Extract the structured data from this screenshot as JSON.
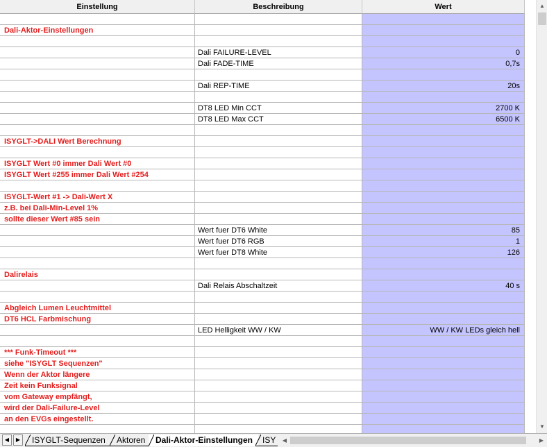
{
  "columns": [
    "Einstellung",
    "Beschreibung",
    "Wert"
  ],
  "rows": [
    [
      "",
      "",
      ""
    ],
    [
      "Dali-Aktor-Einstellungen",
      "",
      ""
    ],
    [
      "",
      "",
      ""
    ],
    [
      "",
      "Dali FAILURE-LEVEL",
      "0"
    ],
    [
      "",
      "Dali FADE-TIME",
      "0,7s"
    ],
    [
      "",
      "",
      ""
    ],
    [
      "",
      "Dali REP-TIME",
      "20s"
    ],
    [
      "",
      "",
      ""
    ],
    [
      "",
      "DT8 LED Min CCT",
      "2700 K"
    ],
    [
      "",
      "DT8 LED Max CCT",
      "6500 K"
    ],
    [
      "",
      "",
      ""
    ],
    [
      "ISYGLT->DALI Wert Berechnung",
      "",
      ""
    ],
    [
      "",
      "",
      ""
    ],
    [
      "ISYGLT Wert #0 immer Dali Wert #0",
      "",
      ""
    ],
    [
      "ISYGLT Wert #255 immer Dali Wert #254",
      "",
      ""
    ],
    [
      "",
      "",
      ""
    ],
    [
      "ISYGLT-Wert #1 -> Dali-Wert X",
      "",
      ""
    ],
    [
      "z.B. bei Dali-Min-Level 1%",
      "",
      ""
    ],
    [
      "sollte dieser Wert #85 sein",
      "",
      ""
    ],
    [
      "",
      "Wert fuer DT6 White",
      "85"
    ],
    [
      "",
      "Wert fuer DT6 RGB",
      "1"
    ],
    [
      "",
      "Wert fuer DT8 White",
      "126"
    ],
    [
      "",
      "",
      ""
    ],
    [
      "Dalirelais",
      "",
      ""
    ],
    [
      "",
      "Dali Relais Abschaltzeit",
      "40 s"
    ],
    [
      "",
      "",
      ""
    ],
    [
      "Abgleich Lumen Leuchtmittel",
      "",
      ""
    ],
    [
      "DT6 HCL Farbmischung",
      "",
      ""
    ],
    [
      "",
      "LED Helligkeit WW / KW",
      "WW / KW LEDs gleich hell"
    ],
    [
      "",
      "",
      ""
    ],
    [
      "*** Funk-Timeout ***",
      "",
      ""
    ],
    [
      "siehe \"ISYGLT Sequenzen\"",
      "",
      ""
    ],
    [
      "Wenn der Aktor längere",
      "",
      ""
    ],
    [
      "Zeit kein Funksignal",
      "",
      ""
    ],
    [
      "vom Gateway empfängt,",
      "",
      ""
    ],
    [
      "wird der Dali-Failure-Level",
      "",
      ""
    ],
    [
      "an den EVGs eingestellt.",
      "",
      ""
    ],
    [
      "",
      "",
      ""
    ]
  ],
  "tabs": [
    {
      "label": "ISYGLT-Sequenzen",
      "active": false
    },
    {
      "label": "Aktoren",
      "active": false
    },
    {
      "label": "Dali-Aktor-Einstellungen",
      "active": true
    },
    {
      "label": "ISY",
      "active": false
    }
  ],
  "icons": {
    "scroll_up": "▲",
    "scroll_down": "▼",
    "scroll_left": "◀",
    "scroll_right": "▶",
    "tab_prev": "◀",
    "tab_next": "▶"
  },
  "colors": {
    "red_text": "#e41d1d",
    "value_bg": "#c4c4ff"
  }
}
